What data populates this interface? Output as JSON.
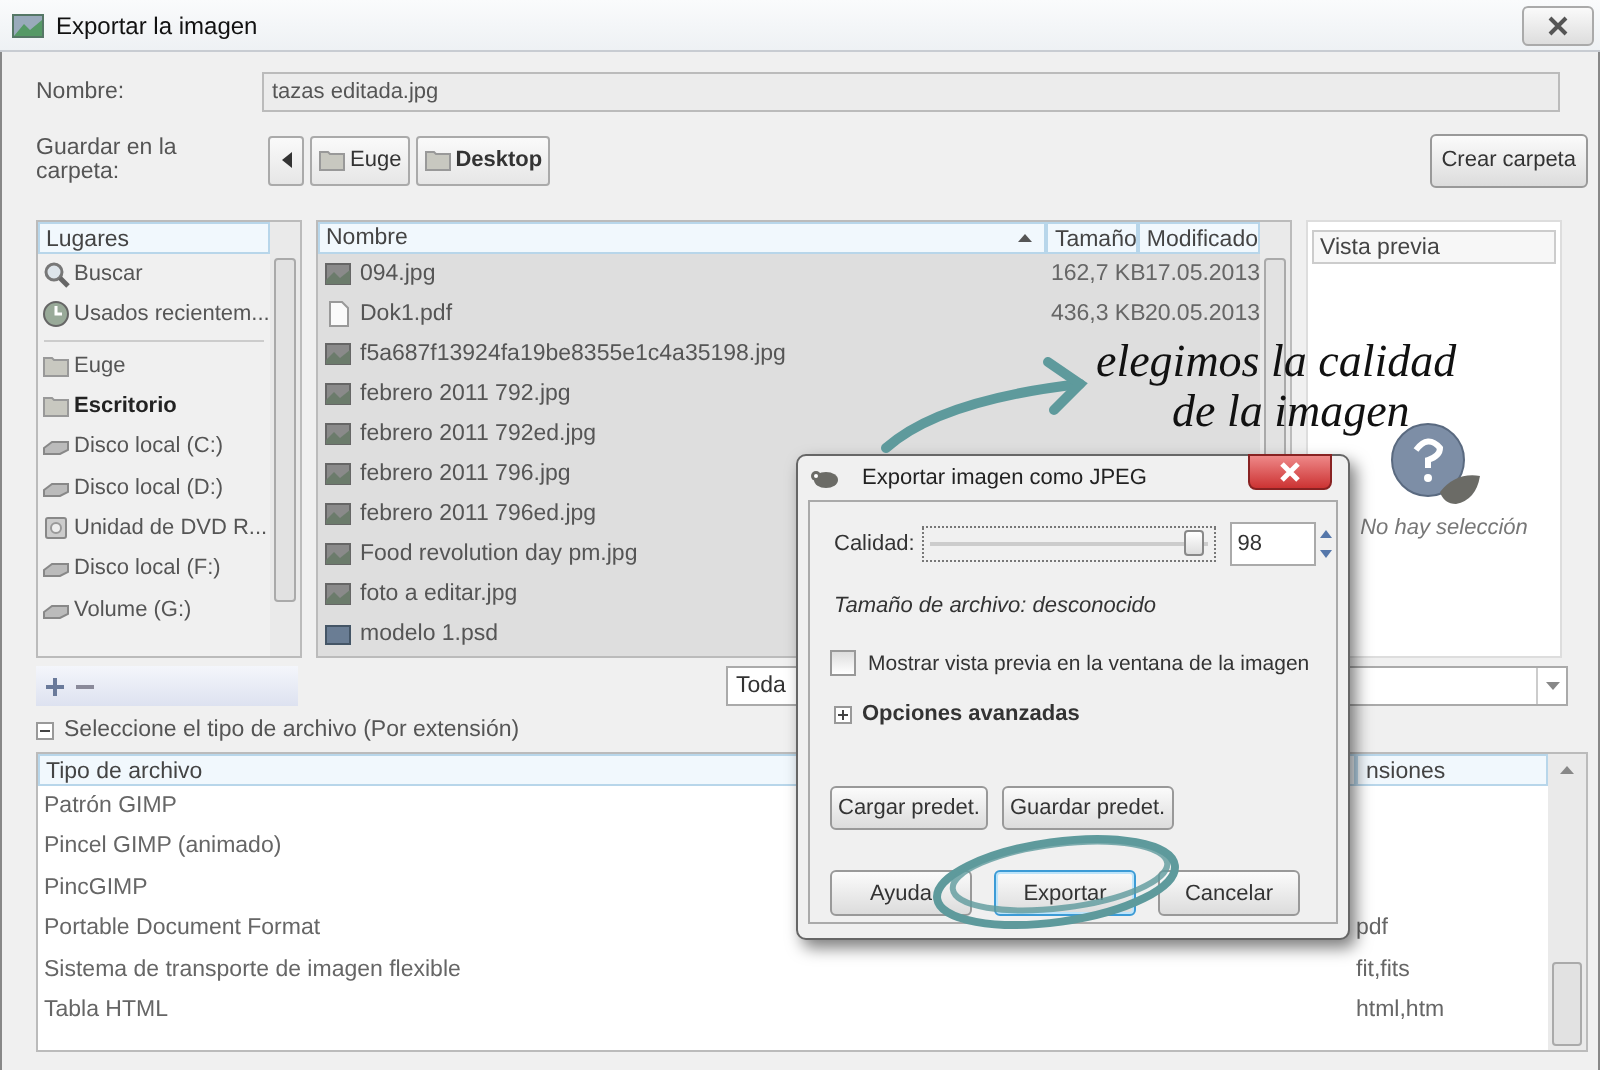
{
  "window": {
    "title": "Exportar la imagen"
  },
  "name_field": {
    "label": "Nombre:",
    "value": "tazas editada.jpg"
  },
  "folder_row": {
    "label": "Guardar en la carpeta:",
    "path": [
      {
        "label": "Euge",
        "current": false
      },
      {
        "label": "Desktop",
        "current": true
      }
    ],
    "create_button": "Crear carpeta"
  },
  "places": {
    "header": "Lugares",
    "groups": [
      [
        {
          "kind": "search",
          "label": "Buscar",
          "current": false
        },
        {
          "kind": "recent",
          "label": "Usados recientem...",
          "current": false
        }
      ],
      [
        {
          "kind": "folder",
          "label": "Euge",
          "current": false
        },
        {
          "kind": "folder",
          "label": "Escritorio",
          "current": true
        },
        {
          "kind": "drive",
          "label": "Disco local (C:)",
          "current": false
        },
        {
          "kind": "drive",
          "label": "Disco local (D:)",
          "current": false
        },
        {
          "kind": "dvd",
          "label": "Unidad de DVD R...",
          "current": false
        },
        {
          "kind": "drive",
          "label": "Disco local (F:)",
          "current": false
        },
        {
          "kind": "drive",
          "label": "Volume (G:)",
          "current": false
        }
      ]
    ]
  },
  "files": {
    "columns": [
      "Nombre",
      "Tamaño",
      "Modificado"
    ],
    "rows": [
      {
        "kind": "image",
        "name": "094.jpg",
        "size": "162,7 KB",
        "modified": "17.05.2013"
      },
      {
        "kind": "pdf",
        "name": "Dok1.pdf",
        "size": "436,3 KB",
        "modified": "20.05.2013"
      },
      {
        "kind": "image",
        "name": "f5a687f13924fa19be8355e1c4a35198.jpg"
      },
      {
        "kind": "image",
        "name": "febrero 2011 792.jpg"
      },
      {
        "kind": "image",
        "name": "febrero 2011 792ed.jpg"
      },
      {
        "kind": "image",
        "name": "febrero 2011 796.jpg"
      },
      {
        "kind": "image",
        "name": "febrero 2011 796ed.jpg"
      },
      {
        "kind": "image",
        "name": "Food revolution day pm.jpg"
      },
      {
        "kind": "image",
        "name": "foto a editar.jpg"
      },
      {
        "kind": "psd",
        "name": "modelo 1.psd"
      }
    ]
  },
  "preview": {
    "header": "Vista previa",
    "empty_text": "No hay selección"
  },
  "filter": {
    "value": "Toda"
  },
  "file_types": {
    "expander": "Seleccione el tipo de archivo (Por extensión)",
    "expanded": true,
    "columns": [
      "Tipo de archivo",
      "nsiones"
    ],
    "rows": [
      {
        "name": "Patrón GIMP"
      },
      {
        "name": "Pincel GIMP (animado)"
      },
      {
        "name": "PincGIMP"
      },
      {
        "name": "Portable Document Format",
        "extensions": "pdf"
      },
      {
        "name": "Sistema de transporte de imagen flexible",
        "extensions": "fit,fits"
      },
      {
        "name": "Tabla HTML",
        "extensions": "html,htm"
      }
    ]
  },
  "jpeg_dialog": {
    "title": "Exportar imagen como JPEG",
    "quality_label": "Calidad:",
    "quality": {
      "level": 0.98,
      "value": "98"
    },
    "file_size": "Tamaño de archivo: desconocido",
    "preview_checkbox": {
      "label": "Mostrar vista previa en la ventana de la imagen",
      "checked": false
    },
    "advanced": {
      "label": "Opciones avanzadas",
      "expanded": false
    },
    "preset_buttons": [
      {
        "label": "Cargar predet.",
        "default": false
      },
      {
        "label": "Guardar predet.",
        "default": false
      }
    ],
    "buttons": [
      {
        "label": "Ayuda",
        "default": false
      },
      {
        "label": "Exportar",
        "default": true
      },
      {
        "label": "Cancelar",
        "default": false
      }
    ]
  },
  "annotation": {
    "lines": [
      "elegimos la calidad",
      "de la imagen"
    ]
  }
}
